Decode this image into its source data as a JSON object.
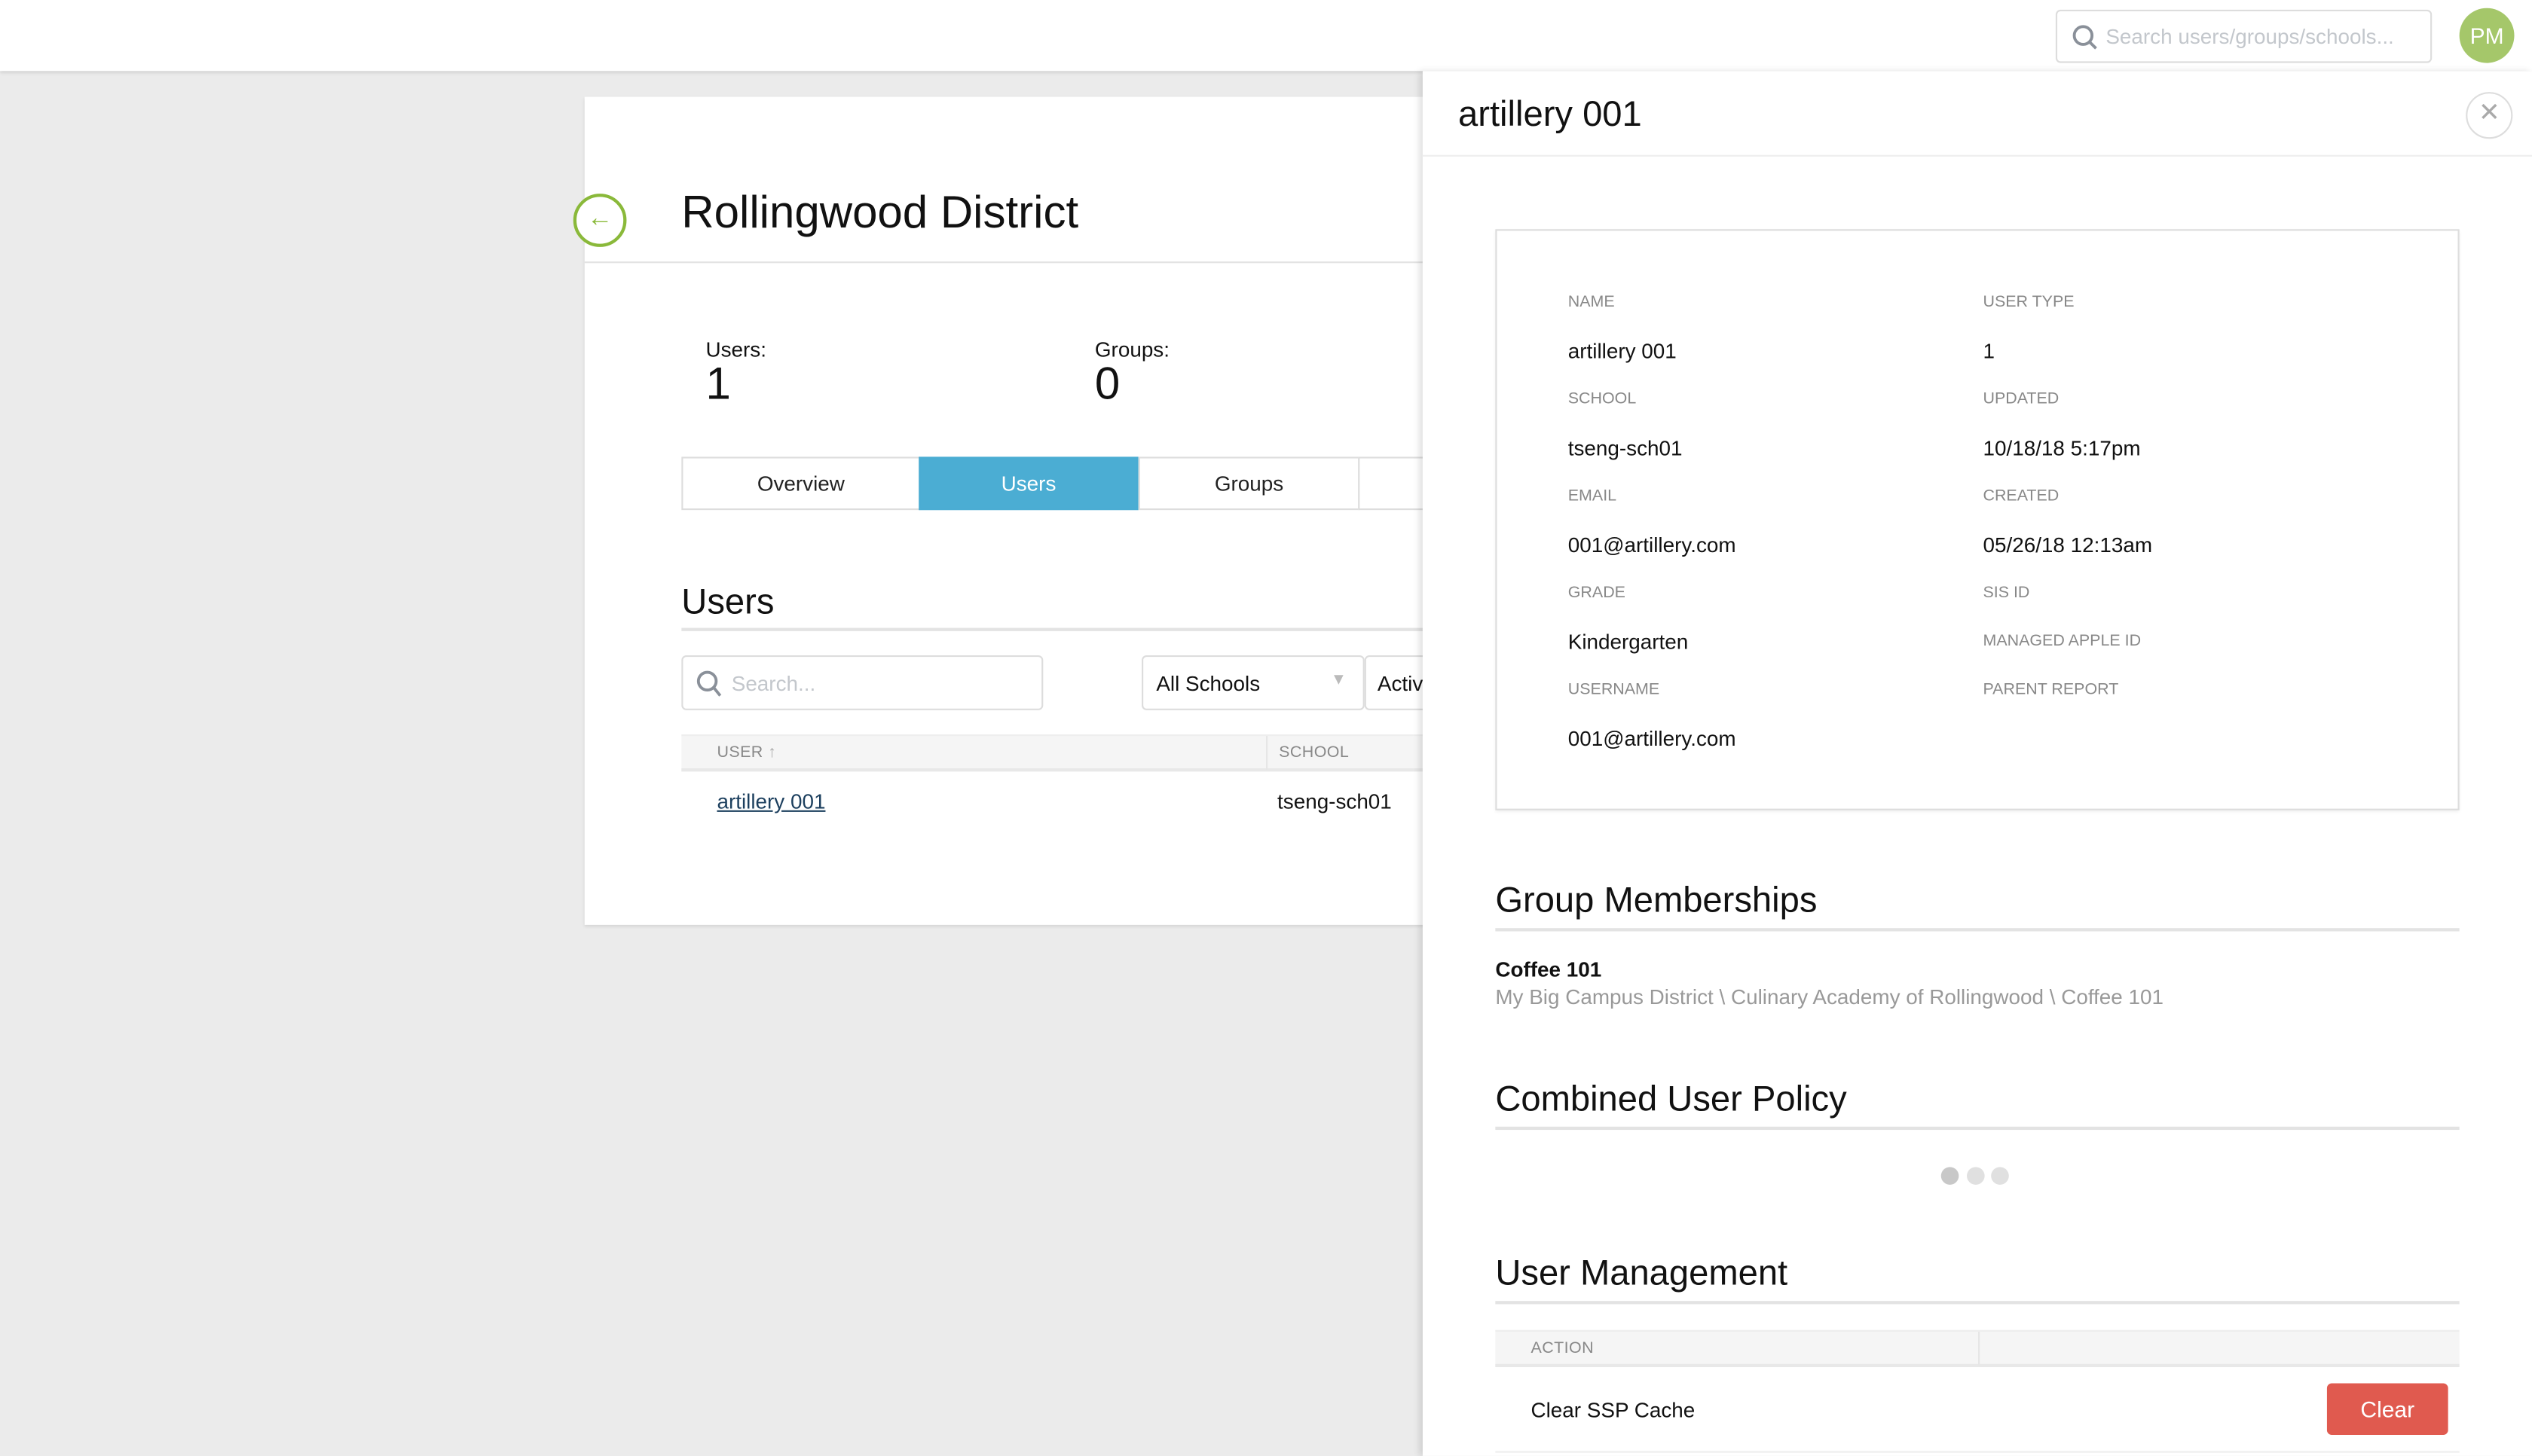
{
  "topbar": {
    "search_placeholder": "Search users/groups/schools...",
    "avatar_initials": "PM",
    "avatar_color": "#a5c76a"
  },
  "district": {
    "title": "Rollingwood District",
    "users_label": "Users:",
    "users_count": "1",
    "groups_label": "Groups:",
    "groups_count": "0",
    "tabs": [
      {
        "label": "Overview"
      },
      {
        "label": "Users",
        "active": true
      },
      {
        "label": "Groups"
      },
      {
        "label": ""
      }
    ],
    "section_title": "Users",
    "search_placeholder": "Search...",
    "school_filter": "All Schools",
    "status_filter": "Activ",
    "table": {
      "columns": [
        "USER",
        "SCHOOL"
      ],
      "rows": [
        {
          "user": "artillery 001",
          "school": "tseng-sch01"
        }
      ]
    }
  },
  "panel": {
    "title": "artillery 001",
    "details_left": [
      {
        "label": "NAME",
        "value": "artillery 001"
      },
      {
        "label": "SCHOOL",
        "value": "tseng-sch01"
      },
      {
        "label": "EMAIL",
        "value": "001@artillery.com"
      },
      {
        "label": "GRADE",
        "value": "Kindergarten"
      },
      {
        "label": "USERNAME",
        "value": "001@artillery.com"
      }
    ],
    "details_right": [
      {
        "label": "USER TYPE",
        "value": "1"
      },
      {
        "label": "UPDATED",
        "value": "10/18/18 5:17pm"
      },
      {
        "label": "CREATED",
        "value": "05/26/18 12:13am"
      },
      {
        "label": "SIS ID"
      },
      {
        "label": "MANAGED APPLE ID"
      },
      {
        "label": "PARENT REPORT"
      }
    ],
    "group_memberships": {
      "title": "Group Memberships",
      "items": [
        {
          "name": "Coffee 101",
          "path": "My Big Campus District \\ Culinary Academy of Rollingwood \\ Coffee 101"
        }
      ]
    },
    "policy": {
      "title": "Combined User Policy"
    },
    "management": {
      "title": "User Management",
      "column": "ACTION",
      "rows": [
        {
          "action": "Clear SSP Cache",
          "button": "Clear"
        }
      ]
    }
  },
  "colors": {
    "accent": "#4badd3",
    "danger": "#e05a4f",
    "back": "#8ab93a"
  }
}
